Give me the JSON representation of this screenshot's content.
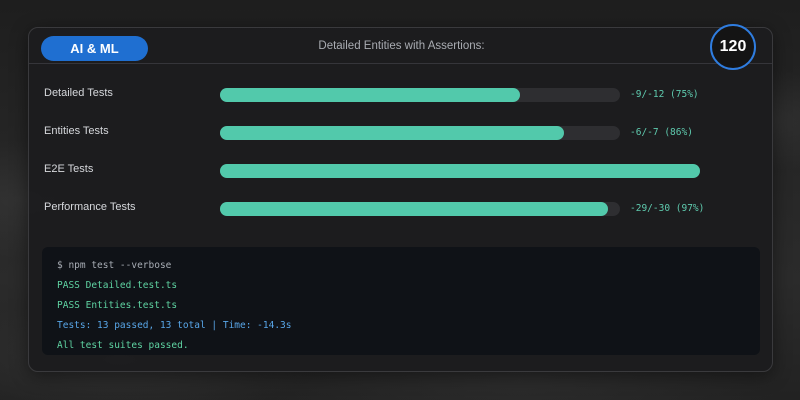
{
  "header": {
    "tag_label": "AI & ML",
    "title": "Detailed Entities with Assertions:",
    "score": "120"
  },
  "colors": {
    "accent": "#1f6fd1",
    "progress_fill": "#52c9ab",
    "score_ring": "#2f7de0"
  },
  "tests": [
    {
      "label": "Detailed Tests",
      "value_text": "-9/-12 (75%)",
      "progress": 0.75
    },
    {
      "label": "Entities Tests",
      "value_text": "-6/-7 (86%)",
      "progress": 0.86
    },
    {
      "label": "E2E Tests",
      "value_text": "",
      "progress": 1.0
    },
    {
      "label": "Performance Tests",
      "value_text": "-29/-30 (97%)",
      "progress": 0.97
    }
  ],
  "terminal": {
    "command": "$ npm test --verbose",
    "lines": [
      "PASS Detailed.test.ts",
      "PASS Entities.test.ts",
      "Tests: 13 passed, 13 total | Time: -14.3s",
      "All test suites passed."
    ]
  }
}
